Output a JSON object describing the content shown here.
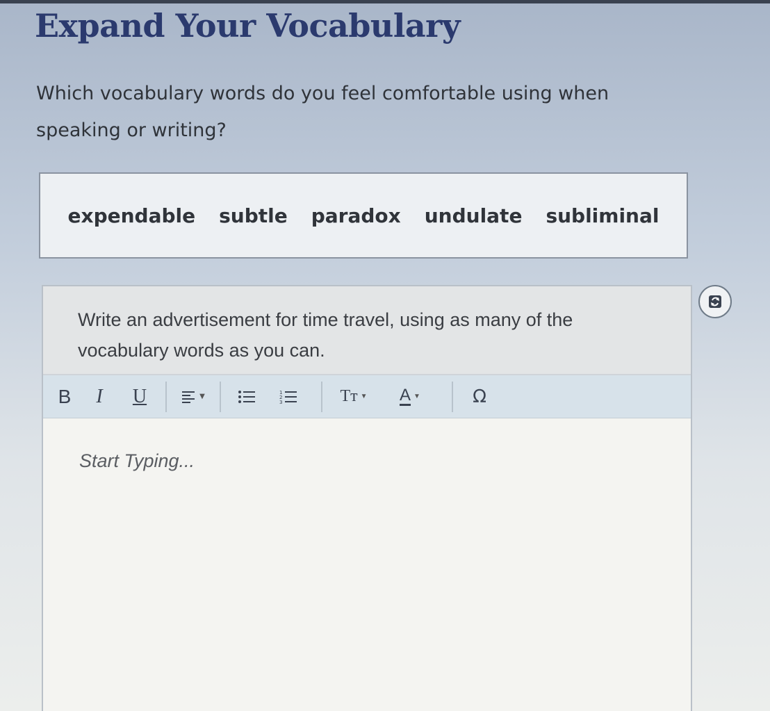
{
  "page": {
    "title": "Expand Your Vocabulary",
    "prompt": "Which vocabulary words do you feel comfortable using when speaking or writing?"
  },
  "word_bank": {
    "words": [
      "expendable",
      "subtle",
      "paradox",
      "undulate",
      "subliminal"
    ]
  },
  "editor": {
    "instructions": "Write an advertisement for time travel, using as many of the vocabulary words as you can.",
    "placeholder": "Start Typing...",
    "toolbar": {
      "bold": "B",
      "italic": "I",
      "underline": "U",
      "align_icon": "align-left-icon",
      "bullets_icon": "bulleted-list-icon",
      "numbered_icon": "numbered-list-icon",
      "font_size_label": "Tт",
      "text_color_label": "A",
      "special_char_label": "Ω"
    }
  },
  "refresh_icon": "refresh-icon",
  "colors": {
    "title": "#2b3a6e",
    "toolbar_bg": "#d7e2ea"
  }
}
